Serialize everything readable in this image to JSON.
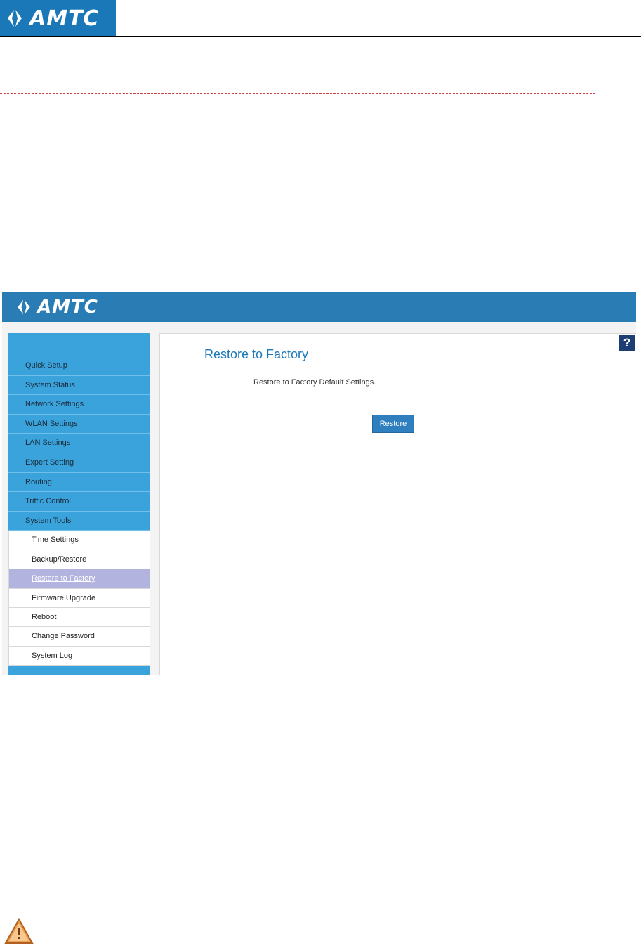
{
  "document": {
    "logo_text": "AMTC"
  },
  "app": {
    "logo_text": "AMTC",
    "help_icon": "?"
  },
  "sidebar": {
    "main_items": [
      {
        "label": "Quick Setup"
      },
      {
        "label": "System Status"
      },
      {
        "label": "Network Settings"
      },
      {
        "label": "WLAN Settings"
      },
      {
        "label": "LAN Settings"
      },
      {
        "label": "Expert Setting"
      },
      {
        "label": "Routing"
      },
      {
        "label": "Triffic Control"
      },
      {
        "label": "System Tools"
      }
    ],
    "sub_items": [
      {
        "label": "Time Settings"
      },
      {
        "label": "Backup/Restore"
      },
      {
        "label": "Restore to Factory",
        "active": true
      },
      {
        "label": "Firmware Upgrade"
      },
      {
        "label": "Reboot"
      },
      {
        "label": "Change Password"
      },
      {
        "label": "System Log"
      }
    ]
  },
  "main": {
    "title": "Restore to Factory",
    "description": "Restore to Factory Default Settings.",
    "restore_button": "Restore"
  },
  "colors": {
    "brand_blue": "#2a7db4",
    "sidebar_blue": "#3aa3dc",
    "active_item": "#b3b3df",
    "button_blue": "#2f7fbf"
  }
}
